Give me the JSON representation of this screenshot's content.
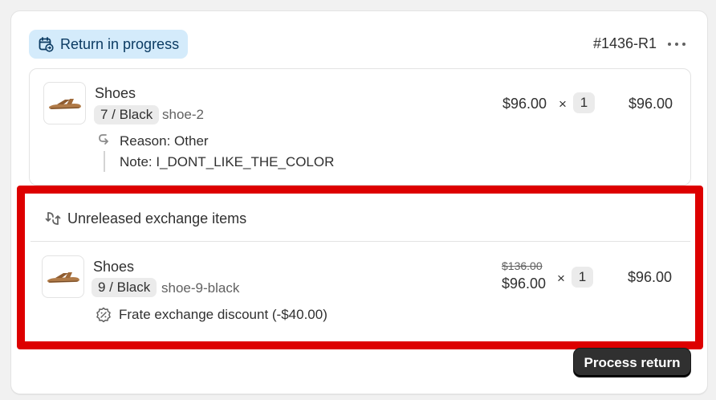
{
  "header": {
    "status_badge": "Return in progress",
    "order_id": "#1436-R1"
  },
  "return_item": {
    "title": "Shoes",
    "variant": "7 / Black",
    "sku": "shoe-2",
    "price": "$96.00",
    "times": "×",
    "quantity": "1",
    "total": "$96.00",
    "reason": "Reason: Other",
    "note": "Note: I_DONT_LIKE_THE_COLOR"
  },
  "exchange": {
    "header": "Unreleased exchange items",
    "item": {
      "title": "Shoes",
      "variant": "9 / Black",
      "sku": "shoe-9-black",
      "original_price": "$136.00",
      "price": "$96.00",
      "times": "×",
      "quantity": "1",
      "total": "$96.00",
      "discount": "Frate exchange discount (-$40.00)"
    }
  },
  "actions": {
    "process_return": "Process return"
  },
  "colors": {
    "badge_bg": "#d4ebfb",
    "highlight_border": "#dd0000",
    "primary_button": "#303030"
  },
  "icons": {
    "status": "return-in-progress-icon",
    "more": "more-horizontal-icon",
    "reason": "return-arrow-icon",
    "exchange": "exchange-arrows-icon",
    "discount": "discount-badge-icon",
    "thumbnail": "sandal-image"
  }
}
